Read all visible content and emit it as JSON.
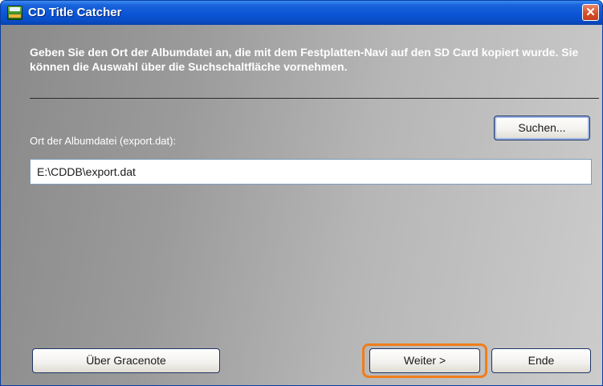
{
  "window": {
    "title": "CD Title Catcher",
    "close_symbol": "✕"
  },
  "dialog": {
    "instruction": "Geben Sie den Ort der Albumdatei an, die mit dem Festplatten-Navi auf den SD Card kopiert wurde. Sie können die Auswahl über die Suchschaltfläche vornehmen.",
    "search_button": "Suchen...",
    "path_label": "Ort der Albumdatei (export.dat):",
    "path_value": "E:\\CDDB\\export.dat"
  },
  "footer": {
    "gracenote_button": "Über Gracenote",
    "next_button": "Weiter >",
    "end_button": "Ende"
  },
  "colors": {
    "titlebar": "#0b55d6",
    "close_button": "#d5502a",
    "highlight": "#f07d1b"
  },
  "icons": {
    "app": "cd-title-catcher-app-icon",
    "close": "close-icon"
  }
}
